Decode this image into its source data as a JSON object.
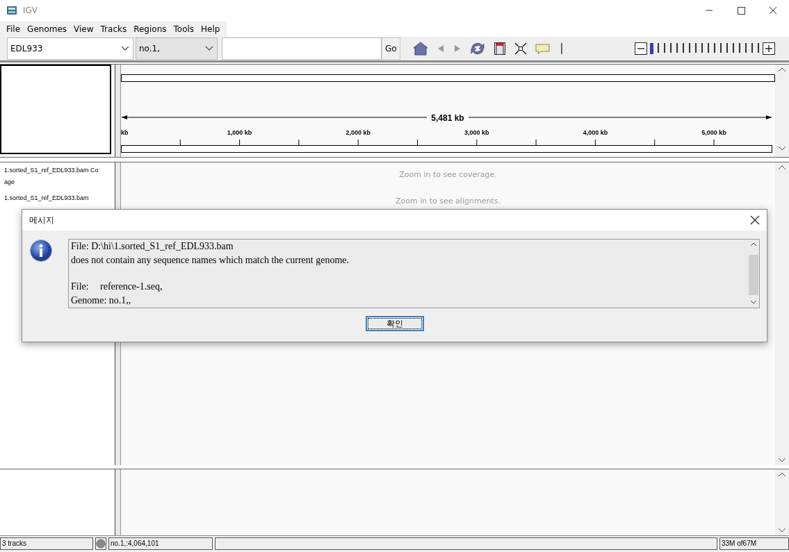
{
  "window": {
    "title": "IGV"
  },
  "menu": [
    "File",
    "Genomes",
    "View",
    "Tracks",
    "Regions",
    "Tools",
    "Help"
  ],
  "toolbar": {
    "genome": "EDL933",
    "chromosome": "no.1,",
    "go": "Go",
    "zoom": {
      "level": 0
    }
  },
  "ruler": {
    "span": "5,481 kb",
    "labels": [
      "kb",
      "1,000 kb",
      "2,000 kb",
      "3,000 kb",
      "4,000 kb",
      "5,000 kb"
    ]
  },
  "tracks": [
    {
      "name_lines": [
        "1.sorted_S1_ref_EDL933.bam Co",
        "age"
      ],
      "message": "Zoom in to see coverage."
    },
    {
      "name_lines": [
        "1.sorted_S1_ref_EDL933.bam"
      ],
      "message": "Zoom in to see alignments."
    }
  ],
  "dialog": {
    "title": "메시지",
    "paragraphs": [
      [
        "File: D:\\hi\\1.sorted_S1_ref_EDL933.bam",
        "does not contain any sequence names which match the current genome."
      ],
      [
        "File:\treference-1.seq,",
        "Genome: no.1,,"
      ]
    ],
    "button": {
      "label": "확인",
      "selected": true
    }
  },
  "status_bar": {
    "tracks": "3 tracks",
    "position": "no.1,:4,064,101",
    "memory": "33M of67M"
  }
}
